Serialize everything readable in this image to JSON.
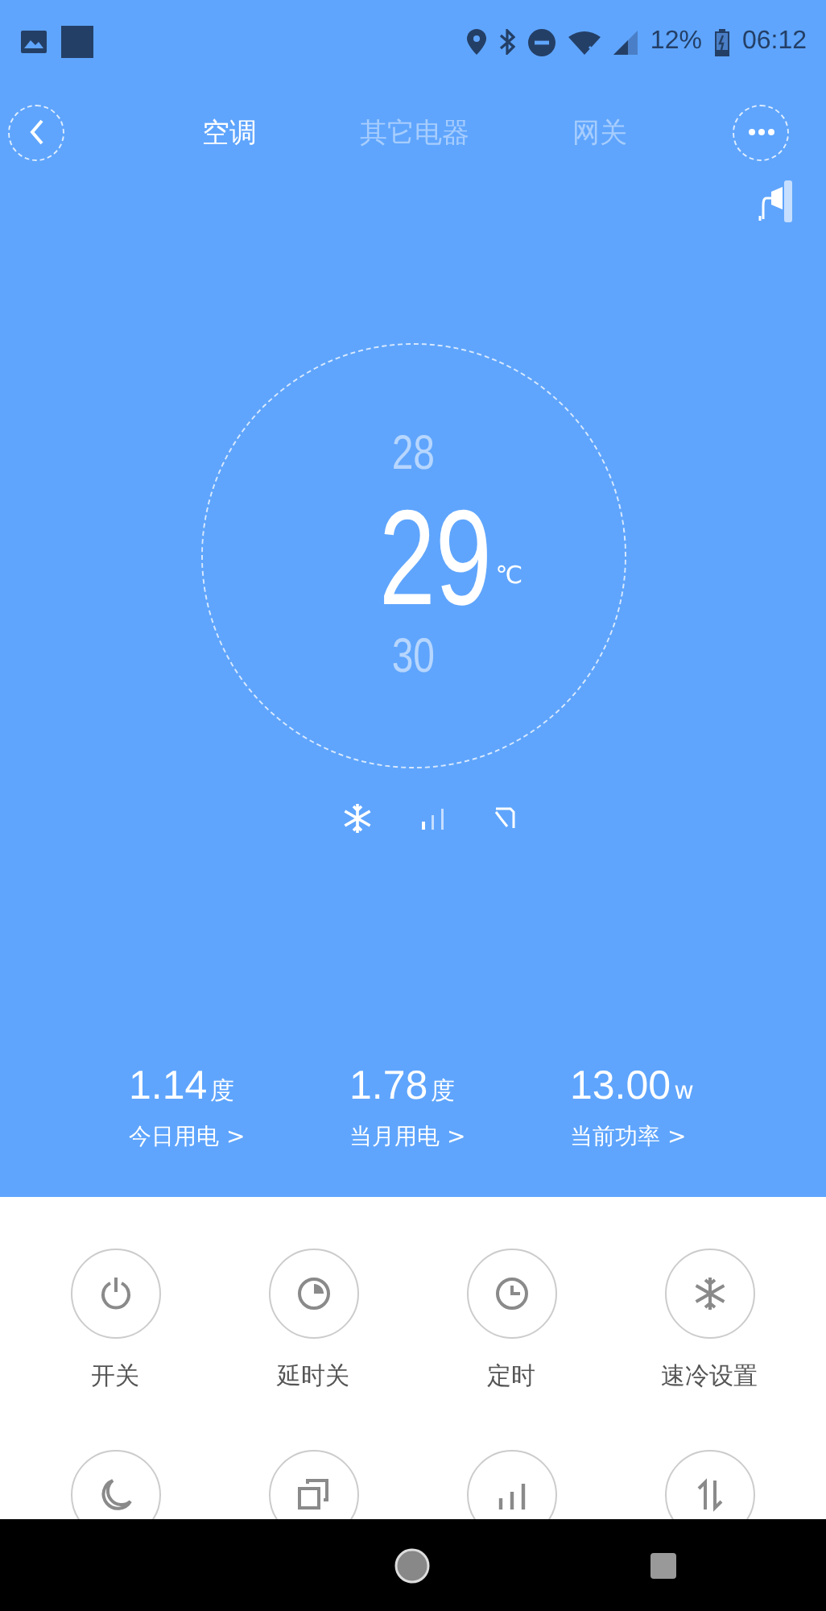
{
  "status_bar": {
    "battery": "12%",
    "time": "06:12"
  },
  "tabs": [
    {
      "label": "空调",
      "selected": true
    },
    {
      "label": "其它电器",
      "selected": false
    },
    {
      "label": "网关",
      "selected": false
    }
  ],
  "dial": {
    "above": "28",
    "current": "29",
    "unit": "℃",
    "below": "30"
  },
  "stats": [
    {
      "value": "1.14",
      "unit": "度",
      "label": "今日用电 >"
    },
    {
      "value": "1.78",
      "unit": "度",
      "label": "当月用电 >"
    },
    {
      "value": "13.00",
      "unit": "w",
      "label": "当前功率 >"
    }
  ],
  "controls": [
    {
      "kind": "power",
      "label": "开关"
    },
    {
      "kind": "delay",
      "label": "延时关"
    },
    {
      "kind": "timer",
      "label": "定时"
    },
    {
      "kind": "cool",
      "label": "速冷设置"
    },
    {
      "kind": "sleep"
    },
    {
      "kind": "copy"
    },
    {
      "kind": "bars"
    },
    {
      "kind": "swap"
    }
  ]
}
